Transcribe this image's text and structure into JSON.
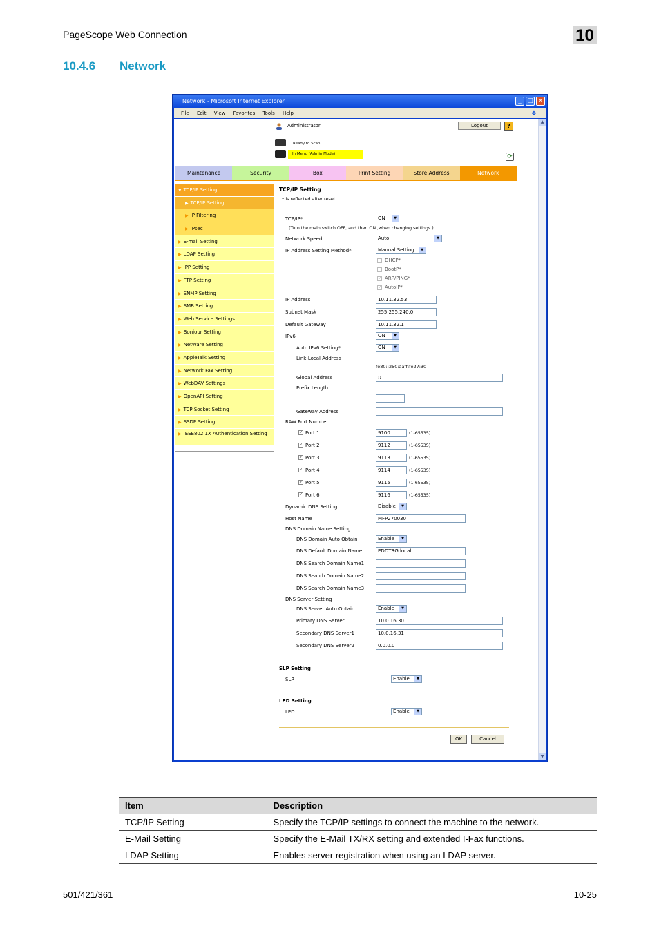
{
  "header": {
    "title": "PageScope Web Connection",
    "chapter": "10"
  },
  "section": {
    "number": "10.4.6",
    "title": "Network"
  },
  "screenshot": {
    "window_title": "Network - Microsoft Internet Explorer",
    "menu": [
      "File",
      "Edit",
      "View",
      "Favorites",
      "Tools",
      "Help"
    ],
    "user": "Administrator",
    "logout_label": "Logout",
    "help_label": "?",
    "status_line1": "Ready to Scan",
    "status_line2": "In Menu (Admin Mode)",
    "tabs": [
      "Maintenance",
      "Security",
      "Box",
      "Print Setting",
      "Store Address",
      "Network"
    ],
    "sidebar": [
      "TCP/IP Setting",
      "TCP/IP Setting",
      "IP Filtering",
      "IPsec",
      "E-mail Setting",
      "LDAP Setting",
      "IPP Setting",
      "FTP Setting",
      "SNMP Setting",
      "SMB Setting",
      "Web Service Settings",
      "Bonjour Setting",
      "NetWare Setting",
      "AppleTalk Setting",
      "Network Fax Setting",
      "WebDAV Settings",
      "OpenAPI Setting",
      "TCP Socket Setting",
      "SSDP Setting",
      "IEEE802.1X Authentication Setting"
    ],
    "form": {
      "title": "TCP/IP Setting",
      "note": "* is reflected after reset.",
      "tcpip_label": "TCP/IP*",
      "tcpip_value": "ON",
      "tcpip_note": "(Turn the main switch OFF, and then ON ,when changing settings.)",
      "speed_label": "Network Speed",
      "speed_value": "Auto",
      "method_label": "IP Address Setting Method*",
      "method_value": "Manual Setting",
      "dhcp": "DHCP*",
      "bootp": "BootP*",
      "arp": "ARP/PING*",
      "autoip": "AutoIP*",
      "ip_label": "IP Address",
      "ip_value": "10.11.32.53",
      "mask_label": "Subnet Mask",
      "mask_value": "255.255.240.0",
      "gw_label": "Default Gateway",
      "gw_value": "10.11.32.1",
      "ipv6_label": "IPv6",
      "ipv6_value": "ON",
      "autoipv6_label": "Auto IPv6 Setting*",
      "autoipv6_value": "ON",
      "linklocal_label": "Link-Local Address",
      "linklocal_value": "fe80::250:aaff:fe27:30",
      "global_label": "Global Address",
      "global_value": "::",
      "prefix_label": "Prefix Length",
      "prefix_value": "",
      "gwaddr_label": "Gateway Address",
      "gwaddr_value": "",
      "raw_label": "RAW Port Number",
      "ports": [
        {
          "label": "Port 1",
          "value": "9100",
          "range": "(1-65535)"
        },
        {
          "label": "Port 2",
          "value": "9112",
          "range": "(1-65535)"
        },
        {
          "label": "Port 3",
          "value": "9113",
          "range": "(1-65535)"
        },
        {
          "label": "Port 4",
          "value": "9114",
          "range": "(1-65535)"
        },
        {
          "label": "Port 5",
          "value": "9115",
          "range": "(1-65535)"
        },
        {
          "label": "Port 6",
          "value": "9116",
          "range": "(1-65535)"
        }
      ],
      "ddns_label": "Dynamic DNS Setting",
      "ddns_value": "Disable",
      "host_label": "Host Name",
      "host_value": "MFP270030",
      "dnsdomain_label": "DNS Domain Name Setting",
      "dnsauto_label": "DNS Domain Auto Obtain",
      "dnsauto_value": "Enable",
      "dnsdefault_label": "DNS Default Domain Name",
      "dnsdefault_value": "EDDTRG.local",
      "dnssearch1_label": "DNS Search Domain Name1",
      "dnssearch2_label": "DNS Search Domain Name2",
      "dnssearch3_label": "DNS Search Domain Name3",
      "dnsserver_label": "DNS Server Setting",
      "dnsserverauto_label": "DNS Server Auto Obtain",
      "dnsserverauto_value": "Enable",
      "primary_label": "Primary DNS Server",
      "primary_value": "10.0.16.30",
      "secondary1_label": "Secondary DNS Server1",
      "secondary1_value": "10.0.16.31",
      "secondary2_label": "Secondary DNS Server2",
      "secondary2_value": "0.0.0.0",
      "slp_title": "SLP Setting",
      "slp_label": "SLP",
      "slp_value": "Enable",
      "lpd_title": "LPD Setting",
      "lpd_label": "LPD",
      "lpd_value": "Enable",
      "ok_label": "OK",
      "cancel_label": "Cancel"
    }
  },
  "table": {
    "headers": [
      "Item",
      "Description"
    ],
    "rows": [
      [
        "TCP/IP Setting",
        "Specify the TCP/IP settings to connect the machine to the network."
      ],
      [
        "E-Mail Setting",
        "Specify the E-Mail TX/RX setting and extended I-Fax functions."
      ],
      [
        "LDAP Setting",
        "Enables server registration when using an LDAP server."
      ]
    ]
  },
  "footer": {
    "model": "501/421/361",
    "page": "10-25"
  }
}
